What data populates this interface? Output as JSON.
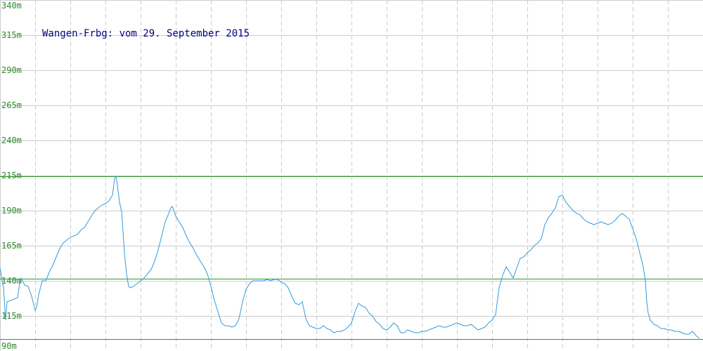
{
  "chart_data": {
    "type": "line",
    "title": "Wangen-Frbg: vom 29. September 2015",
    "xlabel": "",
    "ylabel": "",
    "ylim": [
      90,
      340
    ],
    "yticks": [
      {
        "value": 90,
        "label": "90m"
      },
      {
        "value": 115,
        "label": "115m"
      },
      {
        "value": 140,
        "label": "140m"
      },
      {
        "value": 165,
        "label": "165m"
      },
      {
        "value": 190,
        "label": "190m"
      },
      {
        "value": 215,
        "label": "215m"
      },
      {
        "value": 240,
        "label": "240m"
      },
      {
        "value": 265,
        "label": "265m"
      },
      {
        "value": 290,
        "label": "290m"
      },
      {
        "value": 315,
        "label": "315m"
      },
      {
        "value": 340,
        "label": "340m"
      }
    ],
    "x_gridlines": 19,
    "grid": true,
    "reference_lines": [
      {
        "name": "max",
        "value": 214.5
      },
      {
        "name": "avg",
        "value": 141.5
      },
      {
        "name": "min",
        "value": 98.5
      }
    ],
    "series": [
      {
        "x": [
          0,
          5,
          8,
          10,
          20,
          25,
          28,
          30,
          35,
          40,
          45,
          50,
          52,
          55,
          60,
          65,
          70,
          75,
          80,
          85,
          90,
          95,
          100,
          105,
          110,
          115,
          120,
          125,
          130,
          135,
          140,
          145,
          150,
          155,
          160,
          163,
          165,
          167,
          170,
          173,
          175,
          177,
          180,
          183,
          185,
          190,
          195,
          200,
          205,
          210,
          215,
          220,
          225,
          230,
          235,
          240,
          243,
          245,
          248,
          250,
          255,
          260,
          265,
          270,
          275,
          280,
          285,
          290,
          295,
          300,
          305,
          310,
          315,
          320,
          325,
          330,
          335,
          340,
          345,
          350,
          355,
          360,
          365,
          370,
          375,
          380,
          385,
          390,
          395,
          400,
          405,
          410,
          415,
          420,
          425,
          430,
          435,
          440,
          445,
          450,
          455,
          460,
          465,
          470,
          475,
          480,
          485,
          490,
          495,
          500,
          505,
          510,
          515,
          520,
          525,
          530,
          535,
          540,
          545,
          550,
          555,
          560,
          565,
          570,
          575,
          580,
          585,
          590,
          595,
          600,
          605,
          610,
          615,
          620,
          625,
          630,
          635,
          640,
          645,
          650,
          655,
          660,
          665,
          670,
          675,
          680,
          685,
          690,
          695,
          700,
          705,
          710,
          715,
          720,
          725,
          730,
          735,
          740,
          745,
          750,
          755,
          760,
          765,
          770,
          775,
          780,
          785,
          790,
          795,
          800,
          805,
          810,
          815,
          820,
          825,
          830,
          835,
          840,
          845,
          850,
          855,
          860,
          865,
          870,
          875,
          880,
          885,
          890,
          895,
          900,
          905,
          910,
          915,
          918,
          920,
          922,
          925,
          930,
          935,
          940,
          945,
          950,
          955,
          960,
          965,
          970,
          975,
          980,
          985,
          990,
          995
        ],
        "values": [
          149,
          135,
          112,
          125,
          127,
          128,
          138,
          142,
          137,
          136,
          129,
          119,
          121,
          130,
          140,
          140,
          146,
          151,
          157,
          163,
          167,
          169,
          171,
          172,
          173,
          176,
          178,
          182,
          186,
          190,
          192,
          194,
          195,
          197,
          201,
          213,
          214,
          208,
          196,
          189,
          175,
          160,
          145,
          136,
          135,
          136,
          138,
          140,
          142,
          145,
          148,
          154,
          162,
          172,
          182,
          188,
          192,
          193,
          189,
          186,
          182,
          178,
          172,
          167,
          163,
          158,
          154,
          150,
          145,
          136,
          126,
          118,
          110,
          108,
          108,
          107,
          108,
          113,
          125,
          134,
          138,
          140,
          140,
          140,
          140,
          141,
          140,
          141,
          141,
          139,
          138,
          135,
          129,
          124,
          123,
          125,
          113,
          108,
          107,
          106,
          106,
          108,
          106,
          105,
          103,
          104,
          104,
          105,
          107,
          110,
          118,
          124,
          122,
          121,
          117,
          115,
          111,
          109,
          106,
          105,
          107,
          110,
          108,
          103,
          103,
          105,
          104,
          103,
          103,
          104,
          104,
          105,
          106,
          107,
          108,
          107,
          107,
          108,
          109,
          110,
          109,
          108,
          108,
          109,
          107,
          105,
          106,
          107,
          110,
          112,
          116,
          135,
          144,
          150,
          146,
          142,
          149,
          156,
          157,
          160,
          162,
          165,
          167,
          170,
          180,
          185,
          188,
          192,
          200,
          201,
          196,
          193,
          190,
          188,
          187,
          184,
          182,
          181,
          180,
          181,
          182,
          181,
          180,
          181,
          183,
          186,
          188,
          186,
          184,
          177,
          170,
          160,
          150,
          140,
          125,
          117,
          112,
          109,
          108,
          106,
          106,
          105,
          105,
          104,
          104,
          103,
          102,
          102,
          104,
          101,
          99
        ]
      }
    ]
  },
  "colors": {
    "background": "#ffffff",
    "grid": "#cccccc",
    "line": "#3399dd",
    "reference": "#2a9a2a",
    "ytick_text": "#2e8b2e",
    "title_text": "#000080"
  }
}
